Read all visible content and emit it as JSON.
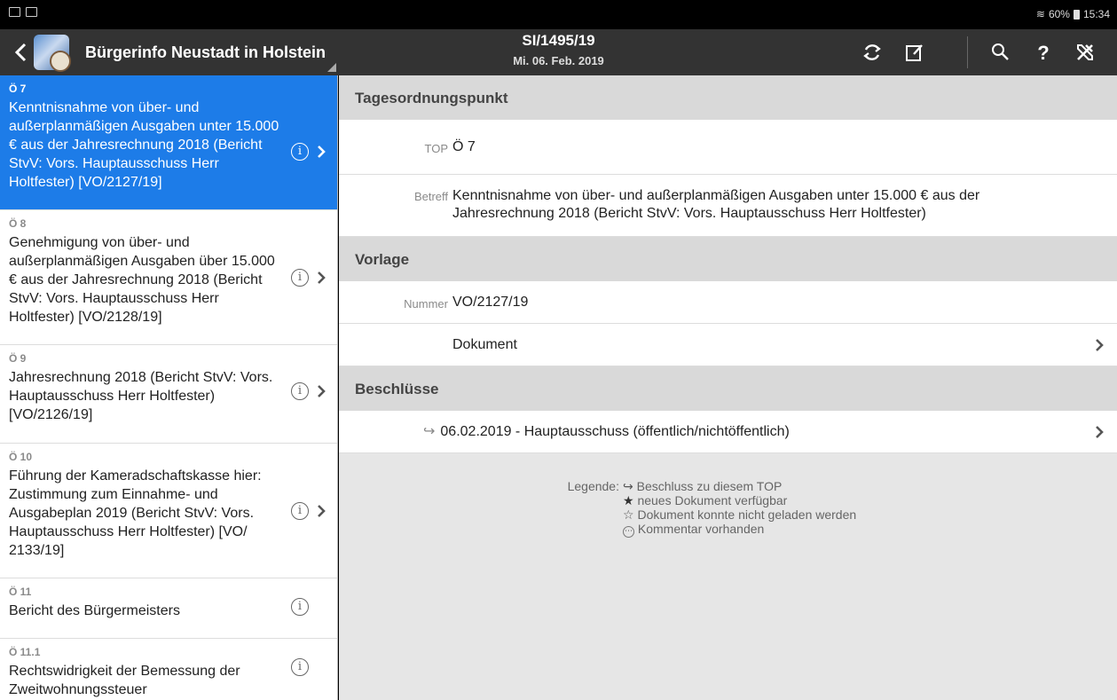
{
  "status_bar": {
    "battery": "60%",
    "time": "15:34"
  },
  "app_bar": {
    "title": "Bürgerinfo Neustadt in Holstein",
    "session_id": "SI/1495/19",
    "session_date": "Mi. 06. Feb. 2019",
    "tools": [
      "refresh-icon",
      "edit-note-icon",
      "search-icon",
      "help-icon",
      "settings-tools-icon"
    ]
  },
  "agenda": [
    {
      "num": "Ö 7",
      "text": "Kenntnisnahme von über- und außerplanmäßigen Ausgaben unter 15.000 € aus der Jahresrechnung 2018 (Bericht StvV: Vors. Hauptausschuss Herr Holtfester) [VO/2127/19]"
    },
    {
      "num": "Ö 8",
      "text": "Genehmigung von über- und außerplanmäßigen Ausgaben über 15.000 € aus der Jahresrechnung 2018 (Bericht StvV: Vors. Hauptausschuss Herr Holtfester) [VO/2128/19]"
    },
    {
      "num": "Ö 9",
      "text": "Jahresrechnung 2018 (Bericht StvV: Vors. Hauptausschuss Herr Holtfester) [VO/2126/19]"
    },
    {
      "num": "Ö 10",
      "text": "Führung der Kameradschaftskasse hier: Zustimmung zum Einnahme- und Ausgabeplan 2019 (Bericht StvV: Vors. Hauptausschuss Herr Holtfester) [VO/ 2133/19]"
    },
    {
      "num": "Ö 11",
      "text": "Bericht des Bürgermeisters"
    },
    {
      "num": "Ö 11.1",
      "text": "Rechtswidrigkeit der Bemessung der Zweitwohnungssteuer"
    }
  ],
  "detail": {
    "section_top": "Tagesordnungspunkt",
    "top_label": "TOP",
    "top_value": "Ö 7",
    "betreff_label": "Betreff",
    "betreff_value": "Kenntnisnahme von über- und außerplanmäßigen Ausgaben unter 15.000 € aus der Jahresrechnung 2018 (Bericht StvV: Vors. Hauptausschuss Herr Holtfester)",
    "section_vorlage": "Vorlage",
    "nummer_label": "Nummer",
    "nummer_value": "VO/2127/19",
    "dokument_label": "Dokument",
    "section_beschluesse": "Beschlüsse",
    "beschluss_arrow": "↪",
    "beschluss_text": "06.02.2019 - Hauptausschuss (öffentlich/nichtöffentlich)"
  },
  "legend": {
    "label": "Legende:",
    "items": [
      {
        "symbol": "↪",
        "text": "Beschluss zu diesem TOP"
      },
      {
        "symbol": "★",
        "text": "neues Dokument verfügbar"
      },
      {
        "symbol": "☆",
        "text": "Dokument konnte nicht geladen werden"
      },
      {
        "symbol": "⋯",
        "text": "Kommentar vorhanden"
      }
    ]
  },
  "colors": {
    "selected": "#1d7ce8",
    "appbar": "#333333",
    "section": "#d9d9d9"
  }
}
